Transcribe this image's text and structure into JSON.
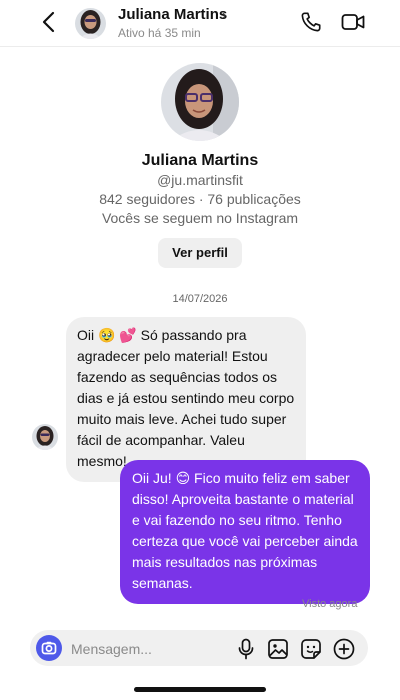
{
  "header": {
    "name": "Juliana Martins",
    "chevron": "›",
    "status": "Ativo há 35 min",
    "icons": {
      "back": "back-arrow-icon",
      "call": "phone-icon",
      "video": "video-camera-icon"
    }
  },
  "profile": {
    "name": "Juliana Martins",
    "handle": "@ju.martinsfit",
    "stats": "842 seguidores · 76 publicações",
    "follow_status": "Vocês se seguem no Instagram",
    "view_button": "Ver perfil"
  },
  "conversation": {
    "date": "14/07/2026",
    "messages": [
      {
        "direction": "incoming",
        "text": "Oii 🥹 💕 Só passando pra agradecer pelo material! Estou fazendo as sequências todos os dias e já estou sentindo meu corpo muito mais leve. Achei tudo super fácil de acompanhar. Valeu mesmo!"
      },
      {
        "direction": "outgoing",
        "text": "Oii Ju! 😊 Fico muito feliz em saber disso! Aproveita bastante o material e vai fazendo no seu ritmo. Tenho certeza que você vai perceber ainda mais resultados nas próximas semanas."
      }
    ],
    "seen_status": "Visto agora"
  },
  "composer": {
    "placeholder": "Mensagem...",
    "icons": [
      "camera-icon",
      "microphone-icon",
      "image-icon",
      "sticker-icon",
      "plus-circle-icon"
    ]
  },
  "colors": {
    "outgoing_bubble": "#7a34e8",
    "incoming_bubble": "#efefef",
    "camera_button": "#4e59e9"
  }
}
